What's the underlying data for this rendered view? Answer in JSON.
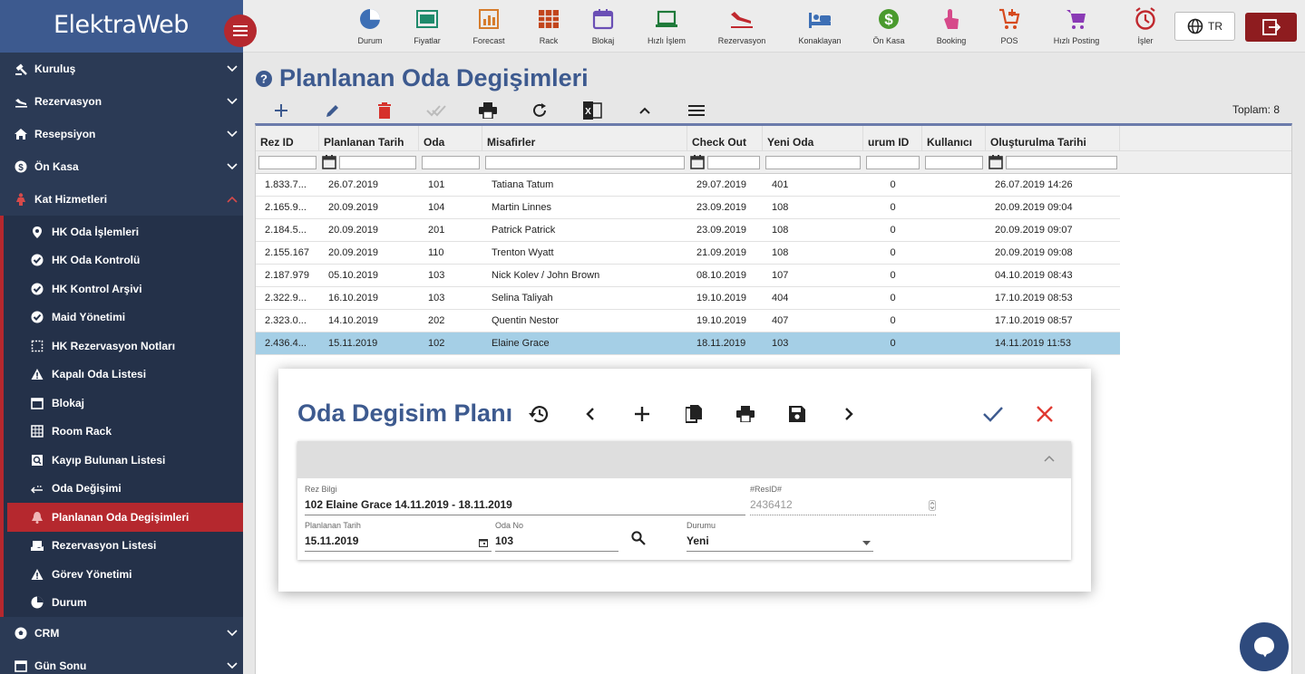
{
  "app": {
    "logo": "ElektraWeb"
  },
  "sidebar": {
    "top": [
      {
        "label": "Kuruluş",
        "icon": "gavel-icon"
      },
      {
        "label": "Rezervasyon",
        "icon": "plane-landing-icon"
      },
      {
        "label": "Resepsiyon",
        "icon": "home-icon"
      },
      {
        "label": "Ön Kasa",
        "icon": "dollar-icon"
      },
      {
        "label": "Kat Hizmetleri",
        "icon": "woman-icon"
      }
    ],
    "sub": [
      {
        "label": "HK Oda İşlemleri",
        "icon": "map-pin-icon"
      },
      {
        "label": "HK Oda Kontrolü",
        "icon": "check-circle-icon"
      },
      {
        "label": "HK Kontrol Arşivi",
        "icon": "check-circle-icon"
      },
      {
        "label": "Maid Yönetimi",
        "icon": "check-circle-icon"
      },
      {
        "label": "HK Rezervasyon Notları",
        "icon": "dotted-square-icon"
      },
      {
        "label": "Kapalı Oda Listesi",
        "icon": "warning-icon"
      },
      {
        "label": "Blokaj",
        "icon": "calendar-icon"
      },
      {
        "label": "Room Rack",
        "icon": "grid-icon"
      },
      {
        "label": "Kayıp Bulunan Listesi",
        "icon": "search-box-icon"
      },
      {
        "label": "Oda Değişimi",
        "icon": "swap-icon"
      },
      {
        "label": "Planlanan Oda Degişimleri",
        "icon": "bell-icon"
      },
      {
        "label": "Rezervasyon Listesi",
        "icon": "hand-box-icon"
      },
      {
        "label": "Görev Yönetimi",
        "icon": "warning-icon"
      },
      {
        "label": "Durum",
        "icon": "pie-chart-icon"
      }
    ],
    "bottom": [
      {
        "label": "CRM",
        "icon": "soccer-icon"
      },
      {
        "label": "Gün Sonu",
        "icon": "calendar-icon"
      }
    ]
  },
  "topbar": {
    "items": [
      {
        "label": "Durum",
        "color": "#3d6fb5"
      },
      {
        "label": "Fiyatlar",
        "color": "#1f8a6b"
      },
      {
        "label": "Forecast",
        "color": "#d67c2c"
      },
      {
        "label": "Rack",
        "color": "#c2451c"
      },
      {
        "label": "Blokaj",
        "color": "#6a4fb5"
      },
      {
        "label": "Hızlı İşlem",
        "color": "#1f7a3a"
      },
      {
        "label": "Rezervasyon",
        "color": "#c0282e"
      },
      {
        "label": "Konaklayan",
        "color": "#3d6fb5"
      },
      {
        "label": "Ön Kasa",
        "color": "#4a9a2e"
      },
      {
        "label": "Booking",
        "color": "#d64a8a"
      },
      {
        "label": "POS",
        "color": "#d64a1e"
      },
      {
        "label": "Hızlı Posting",
        "color": "#8a3ab5"
      },
      {
        "label": "İşler",
        "color": "#c0282e"
      }
    ],
    "lang": "TR"
  },
  "page": {
    "title": "Planlanan Oda Degişimleri",
    "total": "Toplam: 8"
  },
  "grid": {
    "columns": [
      "Rez ID",
      "Planlanan Tarih",
      "Oda",
      "Misafirler",
      "Check Out",
      "Yeni Oda",
      "urum ID",
      "Kullanıcı",
      "Oluşturulma Tarihi"
    ],
    "rows": [
      [
        "1.833.7...",
        "26.07.2019",
        "101",
        "Tatiana Tatum",
        "29.07.2019",
        "401",
        "0",
        "26.07.2019 14:26"
      ],
      [
        "2.165.9...",
        "20.09.2019",
        "104",
        "Martin Linnes",
        "23.09.2019",
        "108",
        "0",
        "20.09.2019 09:04"
      ],
      [
        "2.184.5...",
        "20.09.2019",
        "201",
        "Patrick Patrick",
        "23.09.2019",
        "108",
        "0",
        "20.09.2019 09:07"
      ],
      [
        "2.155.167",
        "20.09.2019",
        "110",
        "Trenton Wyatt",
        "21.09.2019",
        "108",
        "0",
        "20.09.2019 09:08"
      ],
      [
        "2.187.979",
        "05.10.2019",
        "103",
        "Nick Kolev / John Brown",
        "08.10.2019",
        "107",
        "0",
        "04.10.2019 08:43"
      ],
      [
        "2.322.9...",
        "16.10.2019",
        "103",
        "Selina Taliyah",
        "19.10.2019",
        "404",
        "0",
        "17.10.2019 08:53"
      ],
      [
        "2.323.0...",
        "14.10.2019",
        "202",
        "Quentin Nestor",
        "19.10.2019",
        "407",
        "0",
        "17.10.2019 08:57"
      ],
      [
        "2.436.4...",
        "15.11.2019",
        "102",
        "Elaine Grace",
        "18.11.2019",
        "103",
        "0",
        "14.11.2019 11:53"
      ]
    ]
  },
  "modal": {
    "title": "Oda Degisim Planı",
    "rez_label": "Rez Bilgi",
    "rez_value": "102 Elaine Grace 14.11.2019 - 18.11.2019",
    "resid_label": "#ResID#",
    "resid_value": "2436412",
    "date_label": "Planlanan Tarih",
    "date_value": "15.11.2019",
    "room_label": "Oda No",
    "room_value": "103",
    "status_label": "Durumu",
    "status_value": "Yeni"
  }
}
